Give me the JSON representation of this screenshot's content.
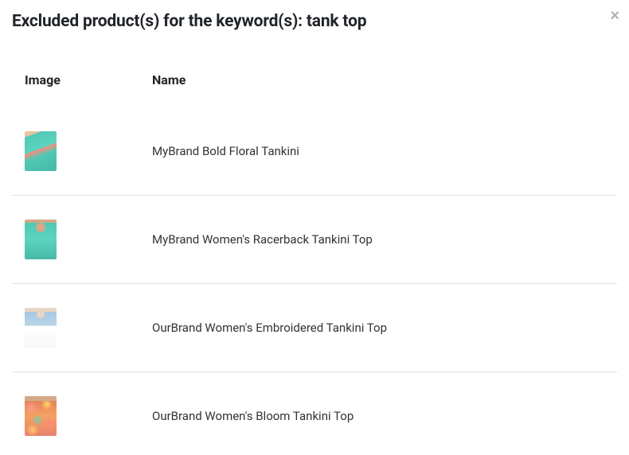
{
  "modal": {
    "title": "Excluded product(s) for the keyword(s): tank top",
    "close": "×"
  },
  "table": {
    "headers": {
      "image": "Image",
      "name": "Name"
    },
    "rows": [
      {
        "name": "MyBrand Bold Floral Tankini",
        "thumb_class": "thumb-1"
      },
      {
        "name": "MyBrand Women's Racerback Tankini Top",
        "thumb_class": "thumb-2"
      },
      {
        "name": "OurBrand Women's Embroidered Tankini Top",
        "thumb_class": "thumb-3"
      },
      {
        "name": "OurBrand Women's Bloom Tankini Top",
        "thumb_class": "thumb-4"
      }
    ]
  }
}
